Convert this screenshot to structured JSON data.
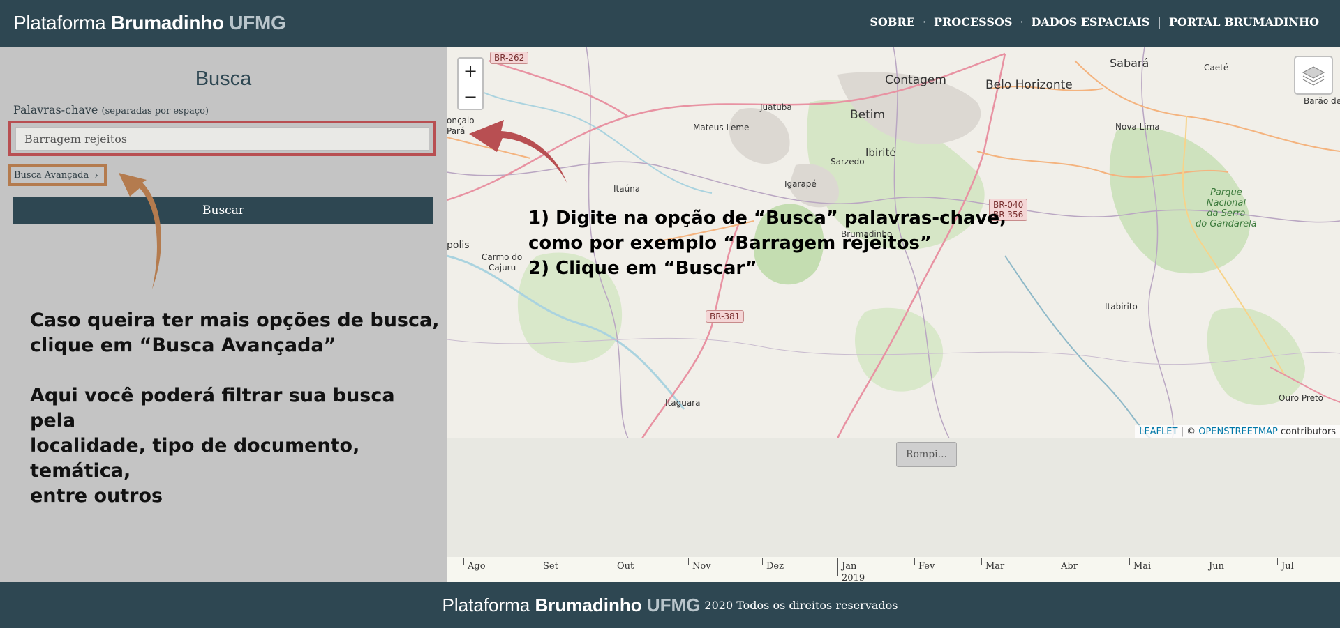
{
  "header": {
    "brand": {
      "part1": "Plataforma",
      "part2": "Brumadinho",
      "part3": "UFMG"
    },
    "nav": [
      {
        "label": "SOBRE"
      },
      {
        "label": "PROCESSOS"
      },
      {
        "label": "DADOS ESPACIAIS"
      },
      {
        "label": "PORTAL BRUMADINHO"
      }
    ],
    "separators": {
      "dot": "·",
      "pipe": "|"
    }
  },
  "search": {
    "title": "Busca",
    "keywords_label": "Palavras-chave",
    "keywords_hint": "(separadas por espaço)",
    "keywords_value": "Barragem rejeitos",
    "advanced_label": "Busca Avançada",
    "advanced_icon": "chevron-right-icon",
    "submit_label": "Buscar"
  },
  "annotations": {
    "advanced_note": [
      "Caso queira ter mais opções de busca,",
      "clique em “Busca Avançada”"
    ],
    "filter_note": [
      "Aqui você poderá filtrar sua busca pela",
      "localidade, tipo de documento, temática,",
      "entre outros"
    ],
    "map_note": [
      "1) Digite na opção de “Busca” palavras-chave,",
      "como por exemplo “Barragem rejeitos”",
      "2) Clique em “Buscar”"
    ]
  },
  "map": {
    "zoom_in": "+",
    "zoom_out": "−",
    "layers_icon": "layers-icon",
    "places": [
      {
        "name": "Sabará"
      },
      {
        "name": "Caeté"
      },
      {
        "name": "Contagem"
      },
      {
        "name": "Belo Horizonte"
      },
      {
        "name": "Barão de Co"
      },
      {
        "name": "Juatuba"
      },
      {
        "name": "Betim"
      },
      {
        "name": "Mateus Leme"
      },
      {
        "name": "Nova Lima"
      },
      {
        "name": "Ibirité"
      },
      {
        "name": "Sarzedo"
      },
      {
        "name": "Igarapé"
      },
      {
        "name": "Itaúna"
      },
      {
        "name": "Brumadinho"
      },
      {
        "name": "Carmo do"
      },
      {
        "name": "Cajuru"
      },
      {
        "name": "polis"
      },
      {
        "name": "onçalo"
      },
      {
        "name": "Pará"
      },
      {
        "name": "Itabirito"
      },
      {
        "name": "Itaguara"
      },
      {
        "name": "Ouro Preto"
      },
      {
        "name": "Parque"
      },
      {
        "name": "Nacional"
      },
      {
        "name": "da Serra"
      },
      {
        "name": "do Gandarela"
      }
    ],
    "roads": [
      {
        "label": "BR-262"
      },
      {
        "label": "BR-040"
      },
      {
        "label": "BR-356"
      },
      {
        "label": "BR-381"
      }
    ],
    "attribution": {
      "leaflet": "LEAFLET",
      "sep": "| ©",
      "osm": "OPENSTREETMAP",
      "rest": "contributors"
    }
  },
  "timeline": {
    "event_label": "Rompi...",
    "months": [
      "Ago",
      "Set",
      "Out",
      "Nov",
      "Dez",
      "Jan",
      "Fev",
      "Mar",
      "Abr",
      "Mai",
      "Jun",
      "Jul"
    ],
    "year": "2019"
  },
  "footer": {
    "brand": {
      "part1": "Plataforma",
      "part2": "Brumadinho",
      "part3": "UFMG"
    },
    "copyright": "2020 Todos os direitos reservados"
  },
  "colors": {
    "header_bg": "#2e4752",
    "sidebar_bg": "#c4c4c4",
    "input_highlight": "#b84f52",
    "advanced_highlight": "#b47b4e",
    "arrow_red": "#b84f52",
    "arrow_orange": "#b47b4e"
  }
}
